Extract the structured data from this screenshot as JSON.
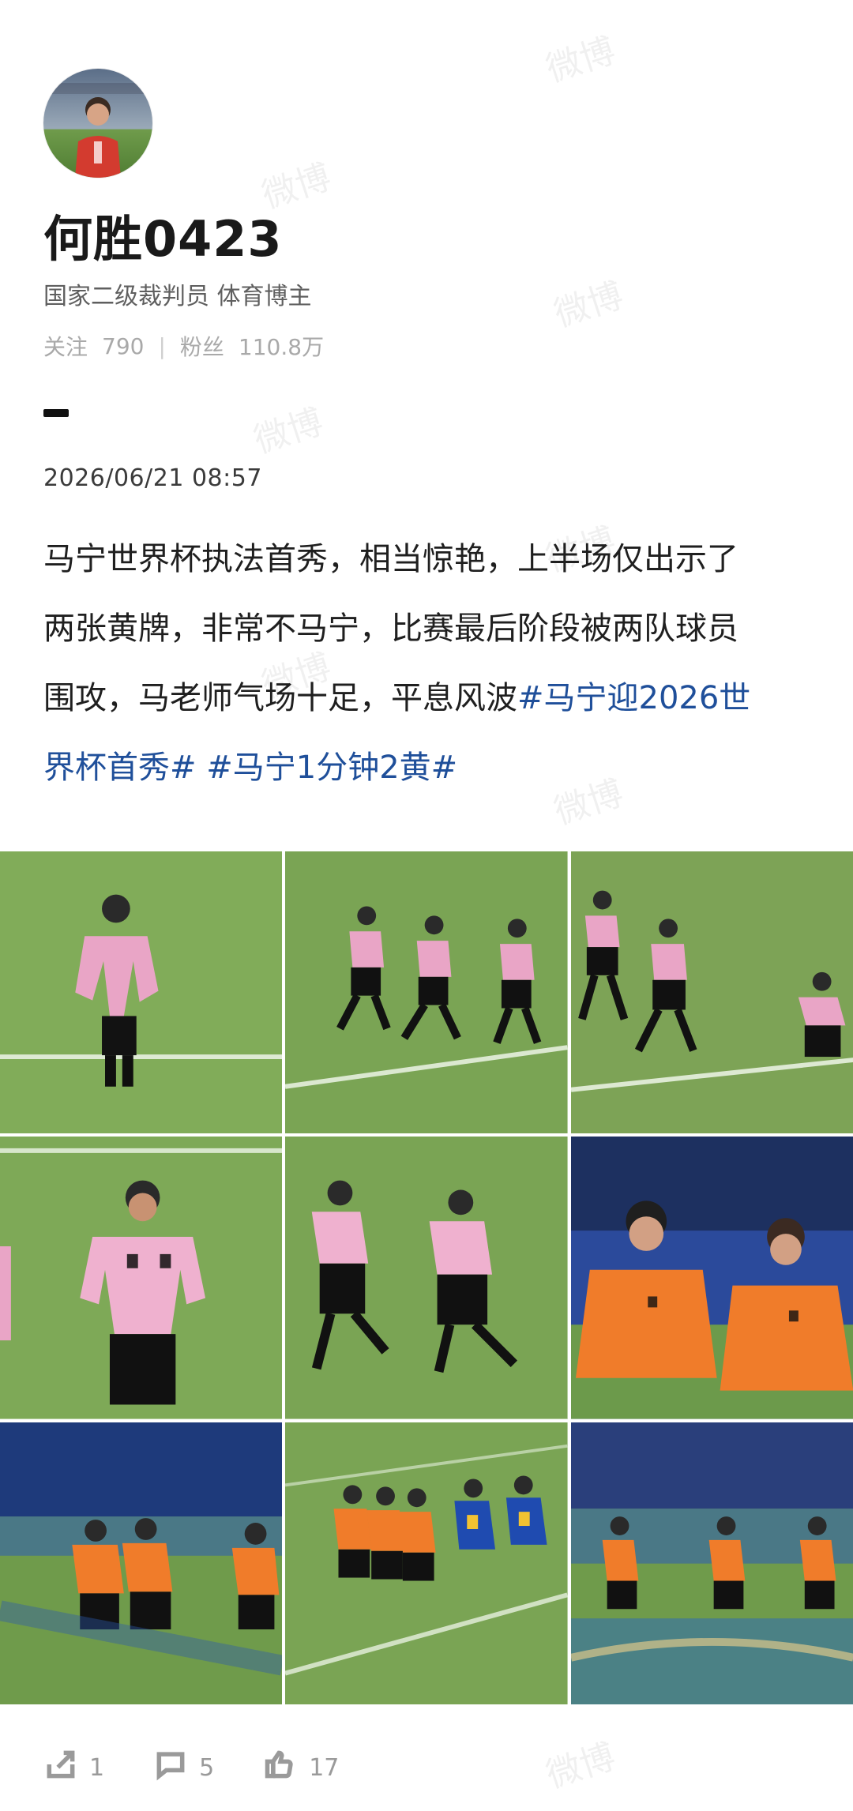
{
  "profile": {
    "name": "何胜0423",
    "bio": "国家二级裁判员 体育博主",
    "following_label": "关注",
    "following_count": "790",
    "fans_label": "粉丝",
    "fans_count": "110.8万"
  },
  "post": {
    "timestamp": "2026/06/21 08:57",
    "text_lines": {
      "l1": "马宁世界杯执法首秀，相当惊艳，上半场仅出示了",
      "l2": "两张黄牌，非常不马宁，比赛最后阶段被两队球员",
      "l3": "围攻，马老师气场十足，平息风波"
    },
    "hashtags": {
      "h1a": "#马宁迎2026世",
      "h1b": "界杯首秀#",
      "h2": "#马宁1分钟2黄#"
    }
  },
  "actions": {
    "repost_count": "1",
    "comment_count": "5",
    "like_count": "17"
  },
  "watermark": "微博",
  "icons": {
    "repost": "share-icon",
    "comment": "comment-icon",
    "like": "thumbs-up-icon"
  },
  "colors": {
    "hashtag": "#1f4f9a",
    "meta": "#a9a9a9",
    "referee_pink": "#e8a7c7",
    "referee_orange": "#f07c2a",
    "pitch_green": "#78a64e"
  }
}
